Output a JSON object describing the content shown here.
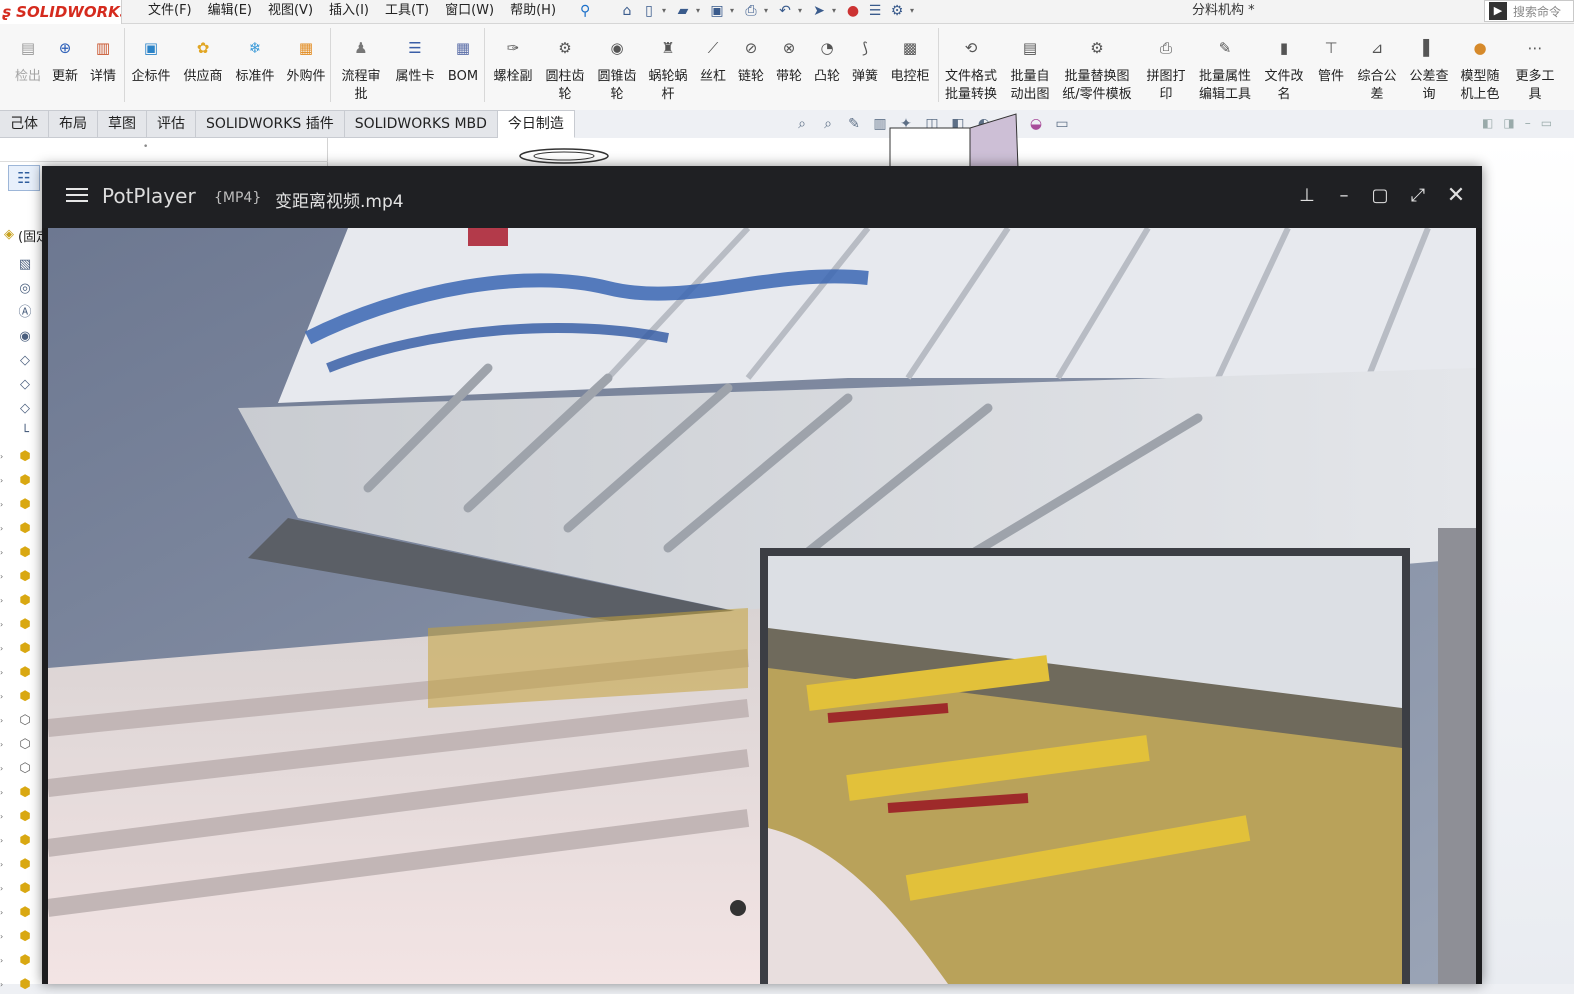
{
  "solidworks": {
    "logo": "SOLIDWORKS",
    "menus": [
      "文件(F)",
      "编辑(E)",
      "视图(V)",
      "插入(I)",
      "工具(T)",
      "窗口(W)",
      "帮助(H)"
    ],
    "doc_title": "分料机构 *",
    "search_placeholder": "搜索命令",
    "ribbon": [
      {
        "label": "检出",
        "disabled": true,
        "icon": "pdm-icon"
      },
      {
        "label": "更新",
        "icon": "update-icon"
      },
      {
        "label": "详情",
        "icon": "details-icon"
      },
      {
        "label": "企标件",
        "icon": "enterprise-part-icon"
      },
      {
        "label": "供应商",
        "icon": "supplier-icon"
      },
      {
        "label": "标准件",
        "icon": "standard-part-icon"
      },
      {
        "label": "外购件",
        "icon": "purchased-part-icon"
      },
      {
        "label": "流程审\n批",
        "icon": "approval-icon"
      },
      {
        "label": "属性卡",
        "icon": "property-card-icon"
      },
      {
        "label": "BOM",
        "icon": "bom-icon"
      },
      {
        "label": "螺栓副",
        "icon": "bolt-icon"
      },
      {
        "label": "圆柱齿\n轮",
        "icon": "spur-gear-icon"
      },
      {
        "label": "圆锥齿\n轮",
        "icon": "bevel-gear-icon"
      },
      {
        "label": "蜗轮蜗\n杆",
        "icon": "worm-gear-icon"
      },
      {
        "label": "丝杠",
        "icon": "lead-screw-icon"
      },
      {
        "label": "链轮",
        "icon": "sprocket-icon"
      },
      {
        "label": "带轮",
        "icon": "pulley-icon"
      },
      {
        "label": "凸轮",
        "icon": "cam-icon"
      },
      {
        "label": "弹簧",
        "icon": "spring-icon"
      },
      {
        "label": "电控柜",
        "icon": "cabinet-icon"
      },
      {
        "label": "文件格式\n批量转换",
        "icon": "format-convert-icon"
      },
      {
        "label": "批量自\n动出图",
        "icon": "auto-drawing-icon"
      },
      {
        "label": "批量替换图\n纸/零件模板",
        "icon": "replace-template-icon"
      },
      {
        "label": "拼图打\n印",
        "icon": "print-icon"
      },
      {
        "label": "批量属性\n编辑工具",
        "icon": "property-edit-icon"
      },
      {
        "label": "文件改\n名",
        "icon": "rename-icon"
      },
      {
        "label": "管件",
        "icon": "pipe-icon"
      },
      {
        "label": "综合公\n差",
        "icon": "tolerance-icon"
      },
      {
        "label": "公差查\n询",
        "icon": "tolerance-query-icon"
      },
      {
        "label": "模型随\n机上色",
        "icon": "random-color-icon"
      },
      {
        "label": "更多工\n具",
        "icon": "more-tools-icon"
      }
    ],
    "tabs": [
      "己体",
      "布局",
      "草图",
      "评估",
      "SOLIDWORKS 插件",
      "SOLIDWORKS MBD",
      "今日制造"
    ],
    "active_tab": 6,
    "tree_root": "(固定)"
  },
  "potplayer": {
    "app_name": "PotPlayer",
    "format": "{MP4}",
    "file_name": "变距离视频.mp4"
  },
  "colors": {
    "sw_red": "#d52b1e",
    "pot_bg": "#1d1d1f"
  }
}
